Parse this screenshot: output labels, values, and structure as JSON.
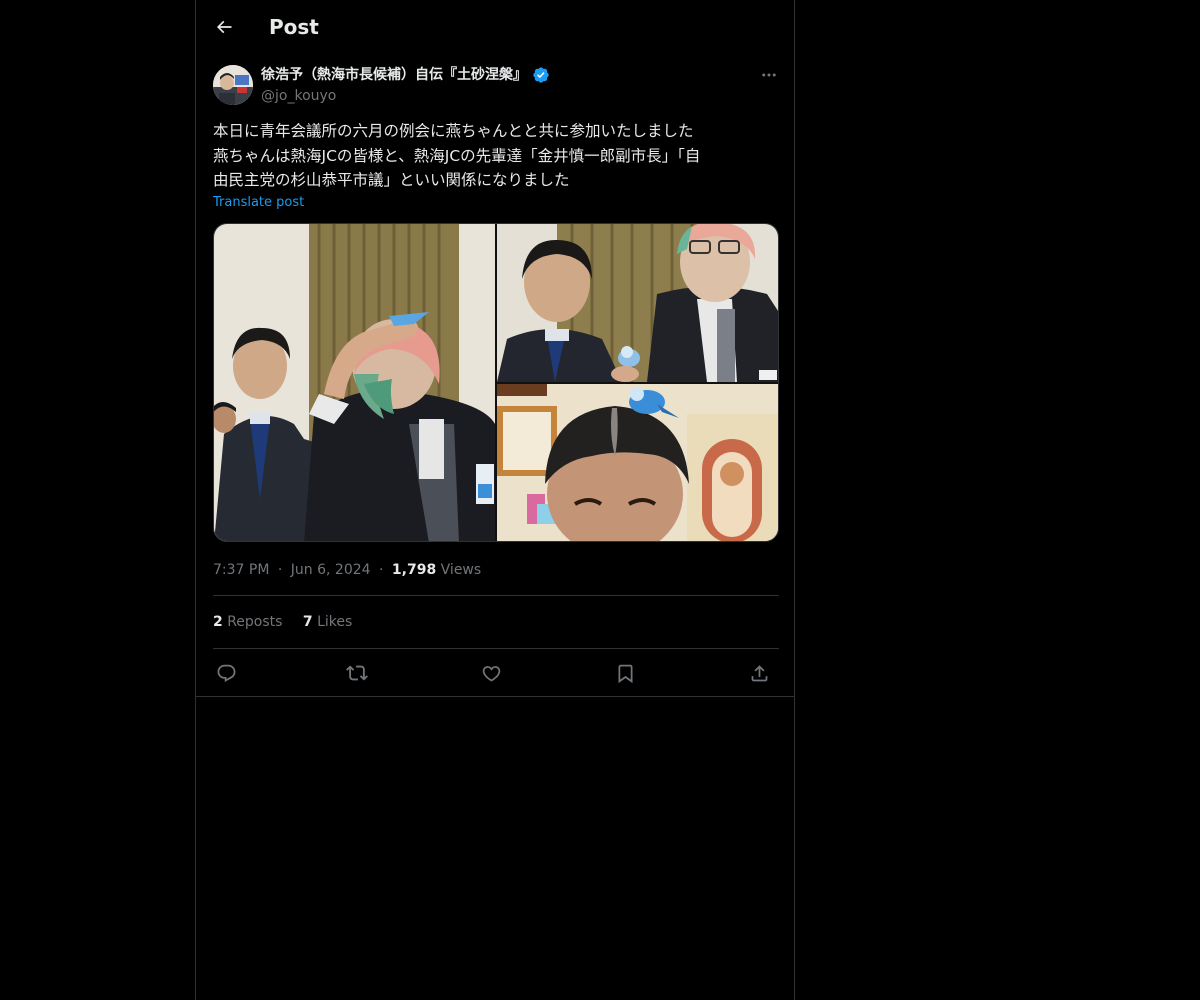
{
  "header": {
    "title": "Post",
    "back_icon": "arrow-left-icon"
  },
  "author": {
    "name": "徐浩予（熱海市長候補）自伝『土砂涅槃』",
    "handle": "@jo_kouyo",
    "verified_color": "#1d9bf0"
  },
  "post": {
    "lines": [
      "本日に青年会議所の六月の例会に燕ちゃんとと共に参加いたしました",
      "燕ちゃんは熱海JCの皆様と、熱海JCの先輩達「金井慎一郎副市長」「自",
      "由民主党の杉山恭平市議」といい関係になりました"
    ],
    "translate_label": "Translate post"
  },
  "meta": {
    "time": "7:37 PM",
    "sep": "·",
    "date": "Jun 6, 2024",
    "views_count": "1,798",
    "views_label": "Views"
  },
  "stats": {
    "reposts_count": "2",
    "reposts_label": "Reposts",
    "likes_count": "7",
    "likes_label": "Likes"
  },
  "colors": {
    "background": "#000000",
    "text": "#e7e9ea",
    "muted": "#71767b",
    "accent": "#1d9bf0",
    "border": "#2f3336"
  }
}
